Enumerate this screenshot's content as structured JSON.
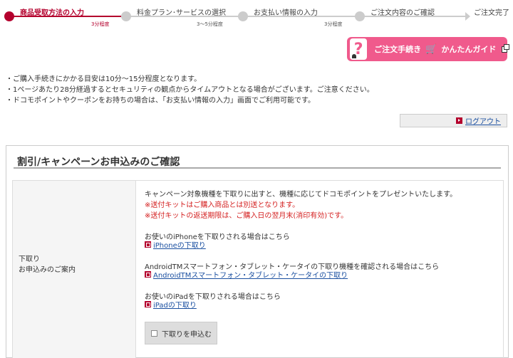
{
  "steps": [
    {
      "label": "商品受取方法の入力",
      "time": "3分程度"
    },
    {
      "label": "料金プラン･サービスの選択",
      "time": "3～5分程度"
    },
    {
      "label": "お支払い情報の入力",
      "time": "3分程度"
    },
    {
      "label": "ご注文内容のご確認",
      "time": ""
    },
    {
      "label": "ご注文完了",
      "time": ""
    }
  ],
  "guide": {
    "q": "?",
    "text1": "ご注文手続き",
    "cart": "🛒",
    "text2": "かんたんガイド"
  },
  "notes": [
    "・ご購入手続きにかかる目安は10分～15分程度となります。",
    "・1ページあたり28分経過するとセキュリティの観点からタイムアウトとなる場合がございます。ご注意ください。",
    "・ドコモポイントやクーポンをお持ちの場合は、「お支払い情報の入力」画面でご利用可能です。"
  ],
  "logout": "ログアウト",
  "panel": {
    "title": "割引/キャンペーンお申込みのご確認",
    "row_header_line1": "下取り",
    "row_header_line2": "お申込みのご案内",
    "intro": "キャンペーン対象機種を下取りに出すと、機種に応じてドコモポイントをプレゼントいたします。",
    "warn1": "※送付キットはご購入商品とは別送となります。",
    "warn2": "※送付キットの返送期限は、ご購入日の翌月末(消印有効)です。",
    "iphone_text": "お使いのiPhoneを下取りされる場合はこちら",
    "iphone_link": "iPhoneの下取り",
    "android_text": "AndroidTMスマートフォン・タブレット・ケータイの下取り機種を確認される場合はこちら",
    "android_link": "AndroidTMスマートフォン・タブレット・ケータイの下取り",
    "ipad_text": "お使いのiPadを下取りされる場合はこちら",
    "ipad_link": "iPadの下取り",
    "apply_label": "下取りを申込む"
  },
  "colors": {
    "accent": "#b4002d",
    "guide_pink": "#f05a8c",
    "link": "#1a4fa0",
    "warn": "#d42020"
  }
}
